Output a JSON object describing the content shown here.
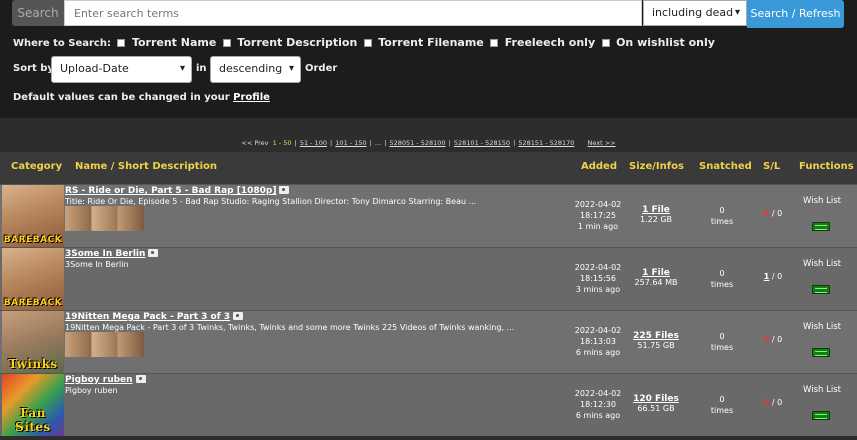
{
  "search": {
    "label": "Search",
    "placeholder": "Enter search terms",
    "including_value": "including dead",
    "button": "Search / Refresh"
  },
  "where": {
    "label": "Where to Search:",
    "options": [
      "Torrent Name",
      "Torrent Description",
      "Torrent Filename",
      "Freeleech only",
      "On wishlist only"
    ]
  },
  "sort": {
    "label": "Sort by",
    "field": "Upload-Date",
    "in_label": "in",
    "order": "descending",
    "order_label": "Order"
  },
  "default_note": {
    "text": "Default values can be changed in your",
    "link": "Profile"
  },
  "pagination": {
    "prev": "<< Prev",
    "current": "1 - 50",
    "pages": [
      "51 - 100",
      "101 - 150",
      "...",
      "528051 - 528100",
      "528101 - 528150",
      "528151 - 528170"
    ],
    "next": "Next >>"
  },
  "table": {
    "headers": {
      "category": "Category",
      "name": "Name / Short Description",
      "added": "Added",
      "size": "Size/Infos",
      "snatched": "Snatched",
      "sl": "S/L",
      "functions": "Functions"
    },
    "rows": [
      {
        "category": "BAREBACK",
        "title": "RS - Ride or Die, Part 5 - Bad Rap [1080p]",
        "desc": "Title: Ride Or Die, Episode 5 - Bad Rap Studio: Raging Stallion Director: Tony Dimarco Starring: Beau ...",
        "date": "2022-04-02",
        "time": "18:17:25",
        "ago": "1 min ago",
        "files": "1 File",
        "size": "1.22 GB",
        "snatched": "0",
        "snatched_unit": "times",
        "seeders": "0",
        "leechers": "0",
        "wish": "Wish List"
      },
      {
        "category": "BAREBACK",
        "title": "3Some In Berlin",
        "desc": "3Some In Berlin",
        "date": "2022-04-02",
        "time": "18:15:56",
        "ago": "3 mins ago",
        "files": "1 File",
        "size": "257.64 MB",
        "snatched": "0",
        "snatched_unit": "times",
        "seeders": "1",
        "leechers": "0",
        "wish": "Wish List"
      },
      {
        "category": "Twinks",
        "title": "19Nitten Mega Pack - Part 3 of 3",
        "desc": "19Nitten Mega Pack - Part 3 of 3 Twinks, Twinks, Twinks and some more Twinks 225 Videos of Twinks wanking, ...",
        "date": "2022-04-02",
        "time": "18:13:03",
        "ago": "6 mins ago",
        "files": "225 Files",
        "size": "51.75 GB",
        "snatched": "0",
        "snatched_unit": "times",
        "seeders": "0",
        "leechers": "0",
        "wish": "Wish List"
      },
      {
        "category": "Fan Sites",
        "title": "Pigboy ruben",
        "desc": "Pigboy ruben",
        "date": "2022-04-02",
        "time": "18:12:30",
        "ago": "6 mins ago",
        "files": "120 Files",
        "size": "66.51 GB",
        "snatched": "0",
        "snatched_unit": "times",
        "seeders": "0",
        "leechers": "0",
        "wish": "Wish List"
      }
    ]
  },
  "colors": {
    "accent": "#3a9ad9",
    "header_text": "#f0d24a",
    "seed_zero": "#e23a3a"
  }
}
